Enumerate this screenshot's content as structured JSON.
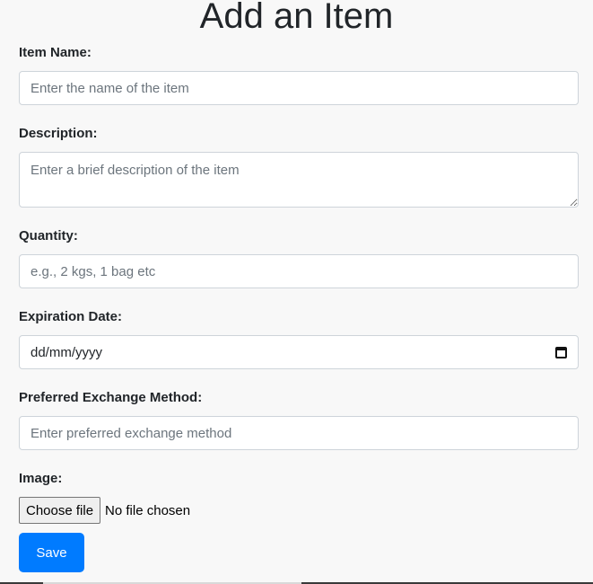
{
  "page": {
    "title": "Add an Item"
  },
  "form": {
    "item_name": {
      "label": "Item Name:",
      "placeholder": "Enter the name of the item",
      "value": ""
    },
    "description": {
      "label": "Description:",
      "placeholder": "Enter a brief description of the item",
      "value": ""
    },
    "quantity": {
      "label": "Quantity:",
      "placeholder": "e.g., 2 kgs, 1 bag etc",
      "value": ""
    },
    "expiration_date": {
      "label": "Expiration Date:",
      "display_value": "dd/mm/yyyy",
      "icon": "calendar-icon"
    },
    "exchange_method": {
      "label": "Preferred Exchange Method:",
      "placeholder": "Enter preferred exchange method",
      "value": ""
    },
    "image": {
      "label": "Image:",
      "button_label": "Choose file",
      "status": "No file chosen"
    },
    "save_label": "Save"
  },
  "colors": {
    "background": "#f8f8f8",
    "primary": "#007bff",
    "text": "#212529",
    "input_border": "#ced4da",
    "placeholder": "#6c757d"
  }
}
